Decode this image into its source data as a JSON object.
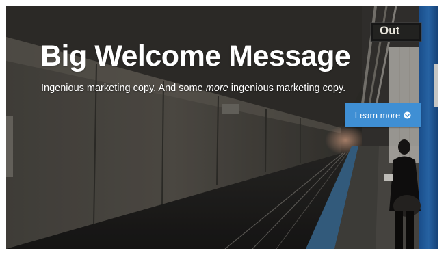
{
  "hero": {
    "title": "Big Welcome Message",
    "copy_before": "Ingenious marketing copy. And some ",
    "copy_emphasis": "more",
    "copy_after": " ingenious marketing copy.",
    "button_label": "Learn more",
    "button_icon": "chevron-circle-down-icon",
    "button_color": "#3f8fd4"
  },
  "background_sign": {
    "text": "Out"
  }
}
